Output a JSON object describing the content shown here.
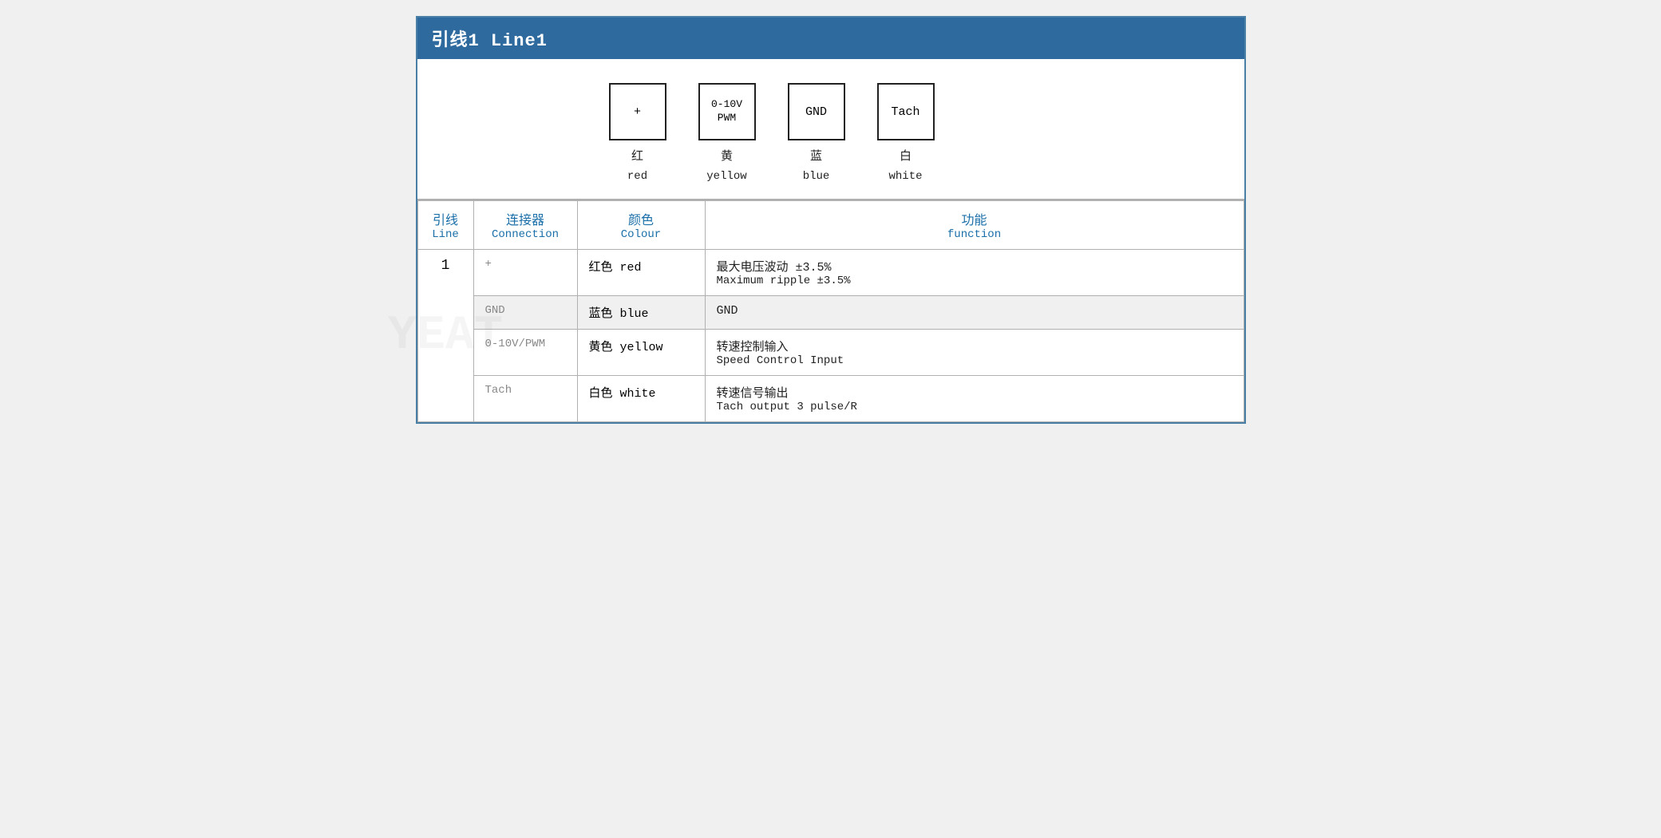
{
  "header": {
    "title": "引线1 Line1"
  },
  "diagram": {
    "connectors": [
      {
        "symbol": "+",
        "label_zh": "红",
        "label_en": "red"
      },
      {
        "symbol": "0-10V\nPWM",
        "label_zh": "黄",
        "label_en": "yellow"
      },
      {
        "symbol": "GND",
        "label_zh": "蓝",
        "label_en": "blue"
      },
      {
        "symbol": "Tach",
        "label_zh": "白",
        "label_en": "white"
      }
    ]
  },
  "table": {
    "headers": {
      "line_zh": "引线",
      "line_en": "Line",
      "connection_zh": "连接器",
      "connection_en": "Connection",
      "colour_zh": "颜色",
      "colour_en": "Colour",
      "function_zh": "功能",
      "function_en": "function"
    },
    "rows": [
      {
        "line": "1",
        "connection": "+",
        "colour_zh": "红色 red",
        "function_zh": "最大电压波动 ±3.5%",
        "function_en": "Maximum ripple ±3.5%",
        "bg": "white"
      },
      {
        "line": "",
        "connection": "GND",
        "colour_zh": "蓝色 blue",
        "function_zh": "GND",
        "function_en": "",
        "bg": "gray"
      },
      {
        "line": "",
        "connection": "0-10V/PWM",
        "colour_zh": "黄色 yellow",
        "function_zh": "转速控制输入",
        "function_en": "Speed Control Input",
        "bg": "white"
      },
      {
        "line": "",
        "connection": "Tach",
        "colour_zh": "白色 white",
        "function_zh": "转速信号输出",
        "function_en": "Tach output 3 pulse/R",
        "bg": "white"
      }
    ]
  }
}
